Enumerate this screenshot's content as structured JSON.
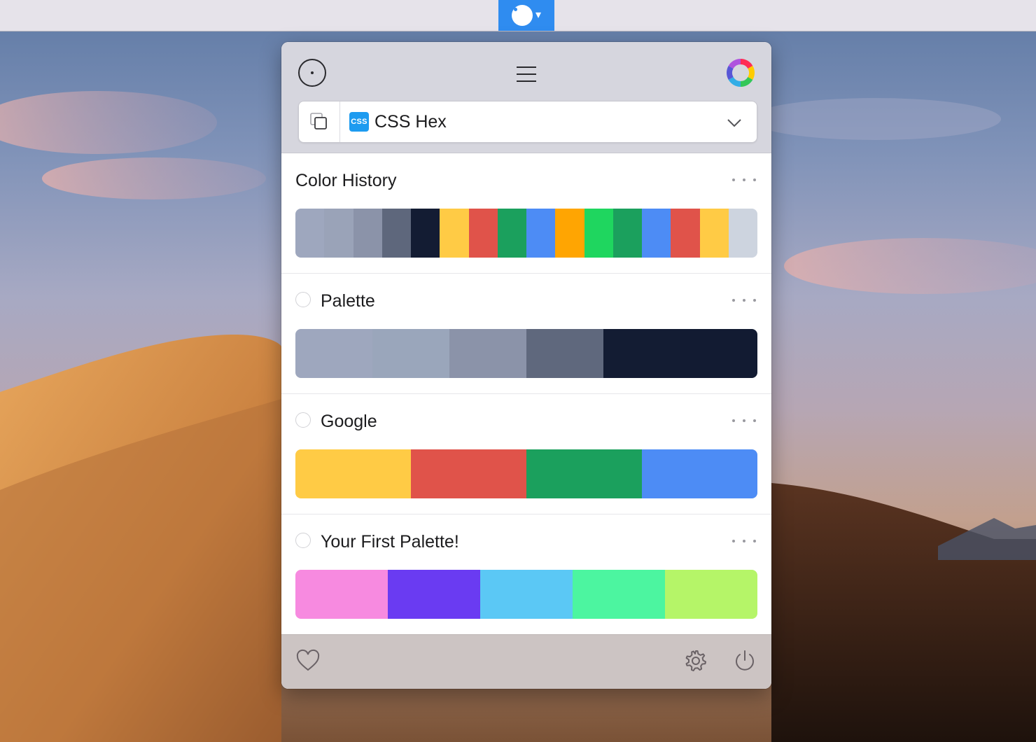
{
  "menubar": {
    "app_icon": "color-picker-blob-icon",
    "caret": "▾",
    "accent": "#2f8cf0"
  },
  "header": {
    "picker_icon": "eyedropper-target-icon",
    "menu_icon": "hamburger-icon",
    "wheel_icon": "color-wheel-icon"
  },
  "format": {
    "badge": "CSS",
    "label": "CSS Hex",
    "copy_icon": "copy-icon",
    "chevron_icon": "chevron-down-icon",
    "badge_color": "#1d9bf0"
  },
  "palettes": [
    {
      "title": "Color History",
      "has_radio": false,
      "colors": [
        "#9ea7be",
        "#9aa3b8",
        "#8b93a9",
        "#5e677c",
        "#131c33",
        "#ffcb45",
        "#e0534a",
        "#1ba05d",
        "#4d8cf5",
        "#ffa502",
        "#1fd65f",
        "#1ba05d",
        "#4d8cf5",
        "#e0534a",
        "#ffcb45",
        "#cdd4df"
      ]
    },
    {
      "title": "Palette",
      "has_radio": true,
      "colors": [
        "#9ea7be",
        "#9aa6bb",
        "#8b93a9",
        "#5f687d",
        "#131c33",
        "#121b32"
      ]
    },
    {
      "title": "Google",
      "has_radio": true,
      "colors": [
        "#ffcb45",
        "#e0534a",
        "#1ba05d",
        "#4d8cf5"
      ]
    },
    {
      "title": "Your First Palette!",
      "has_radio": true,
      "colors": [
        "#f78ae0",
        "#6a3bf2",
        "#5bc8f5",
        "#4cf5a0",
        "#b5f568"
      ]
    }
  ],
  "footer": {
    "heart_icon": "heart-icon",
    "gear_icon": "gear-icon",
    "power_icon": "power-icon"
  }
}
